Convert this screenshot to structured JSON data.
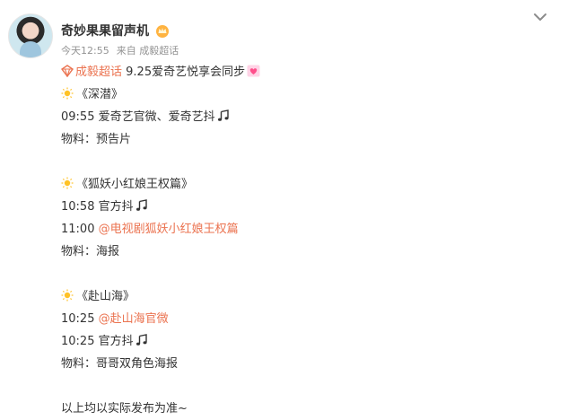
{
  "post": {
    "author": "奇妙果果留声机",
    "time": "今天12:55",
    "source": "来自 成毅超话",
    "topic_link": "成毅超话",
    "intro": " 9.25爱奇艺悦享会同步",
    "sections": [
      {
        "title": "《深潜》",
        "lines": [
          {
            "time": "09:55",
            "text": "爱奇艺官微、爱奇艺抖",
            "icon": "music-note-icon"
          },
          {
            "label": "物料：",
            "text": "预告片"
          }
        ]
      },
      {
        "title": "《狐妖小红娘王权篇》",
        "lines": [
          {
            "time": "10:58",
            "text": "官方抖",
            "icon": "music-note-icon"
          },
          {
            "time": "11:00",
            "link": "@电视剧狐妖小红娘王权篇"
          },
          {
            "label": "物料：",
            "text": "海报"
          }
        ]
      },
      {
        "title": "《赴山海》",
        "lines": [
          {
            "time": "10:25",
            "link": "@赴山海官微"
          },
          {
            "time": "10:25",
            "text": "官方抖",
            "icon": "music-note-icon"
          },
          {
            "label": "物料：",
            "text": "哥哥双角色海报"
          }
        ]
      }
    ],
    "footer": "以上均以实际发布为准~"
  },
  "colors": {
    "link": "#eb7350",
    "meta": "#939393",
    "text": "#333333"
  }
}
